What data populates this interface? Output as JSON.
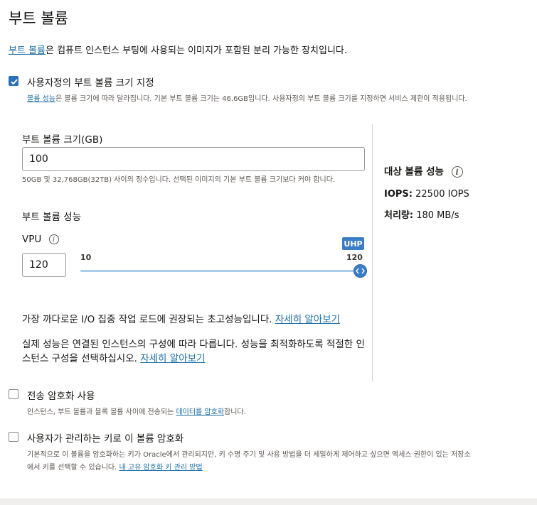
{
  "page": {
    "title": "부트 볼륨",
    "intro_link": "부트 볼륨",
    "intro_rest": "은 컴퓨트 인스턴스 부팅에 사용되는 이미지가 포함된 분리 가능한 장치입니다."
  },
  "custom_size": {
    "checked": true,
    "label": "사용자정의 부트 볼륨 크기 지정",
    "hint_link": "볼륨 성능",
    "hint_rest": "은 볼륨 크기에 따라 달라집니다. 기본 부트 볼륨 크기는 46.6GB입니다. 사용자정의 부트 볼륨 크기를 지정하면 서비스 제한이 적용됩니다."
  },
  "size_field": {
    "label": "부트 볼륨 크기(GB)",
    "value": "100",
    "help": "50GB 및 32,768GB(32TB) 사이의 정수입니다. 선택된 이미지의 기본 부트 볼륨 크기보다 커야 합니다."
  },
  "performance": {
    "label": "부트 볼륨 성능",
    "vpu_label": "VPU",
    "vpu_value": "120",
    "slider_min": "10",
    "slider_max": "120",
    "slider_value_fraction": 1.0,
    "badge": "UHP",
    "desc1": "가장 까다로운 I/O 집중 작업 로드에 권장되는 초고성능입니다. ",
    "desc1_link": "자세히 알아보기",
    "desc2": "실제 성능은 연결된 인스턴스의 구성에 따라 다릅니다. 성능을 최적화하도록 적절한 인스턴스 구성을 선택하십시오. ",
    "desc2_link": "자세히 알아보기"
  },
  "target": {
    "title": "대상 볼륨 성능",
    "iops_label": "IOPS:",
    "iops_value": "22500 IOPS",
    "throughput_label": "처리량:",
    "throughput_value": "180 MB/s"
  },
  "in_transit": {
    "checked": false,
    "label": "전송 암호화 사용",
    "hint_pre": "인스턴스, 부트 볼륨과 블록 볼륨 사이에 전송되는 ",
    "hint_link": "데이터를 암호화",
    "hint_post": "합니다."
  },
  "customer_key": {
    "checked": false,
    "label": "사용자가 관리하는 키로 이 볼륨 암호화",
    "hint_line1": "기본적으로 이 볼륨을 암호화하는 키가 Oracle에서 관리되지만, 키 수명 주기 및 사용 방법을 더 세밀하게 제어하고 싶으면 액세스 권한이 있는 저장소",
    "hint_line2": "에서 키를 선택할 수 있습니다. ",
    "hint_link": "내 고유 암호화 키 관리 방법"
  },
  "colors": {
    "accent": "#3b7dc4",
    "link": "#1b6ea8",
    "checkbox_checked": "#2a6fb7"
  },
  "icons": {
    "check": "check-icon",
    "info": "info-icon",
    "slider_handle": "chevrons-left-right-icon"
  }
}
